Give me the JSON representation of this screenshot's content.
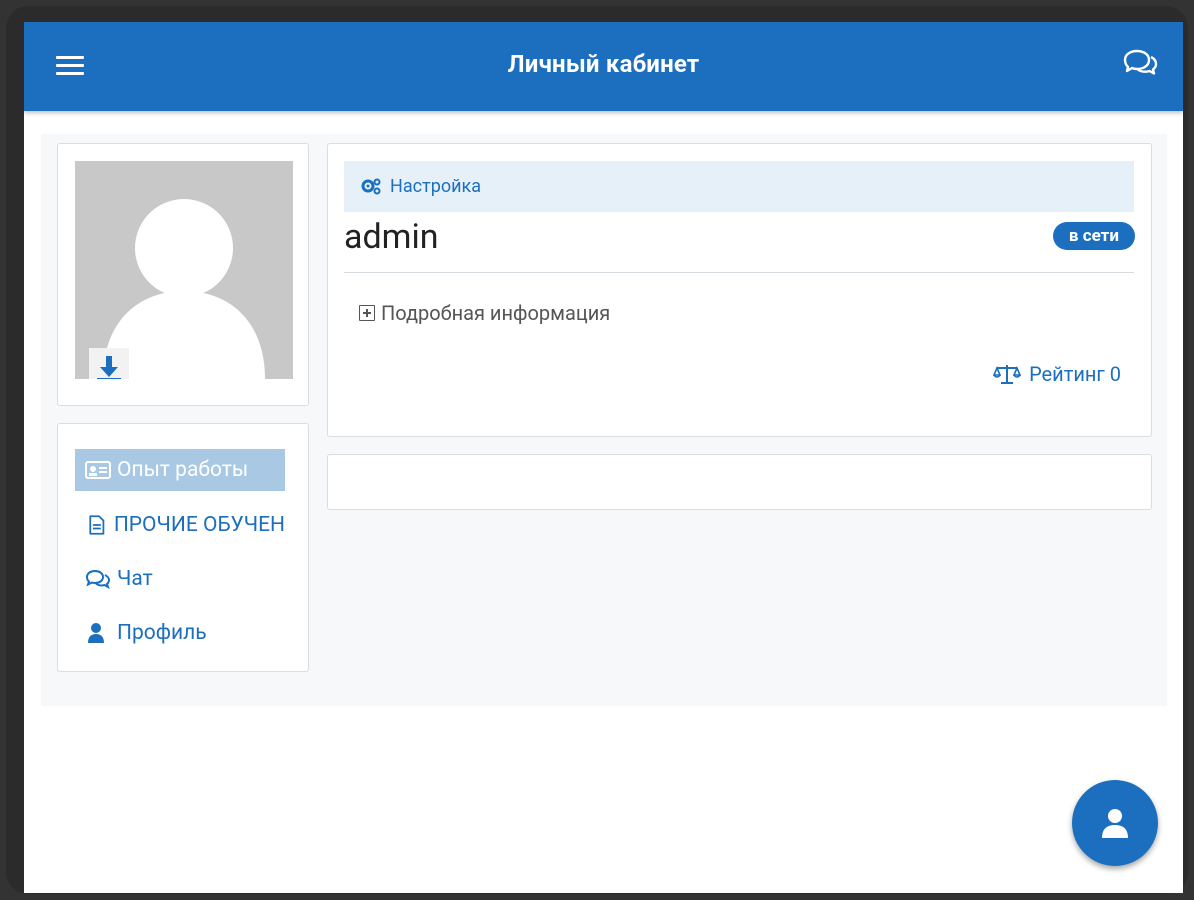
{
  "header": {
    "title": "Личный кабинет"
  },
  "profile": {
    "username": "admin",
    "status_badge": "в сети",
    "settings_label": "Настройка",
    "details_label": "Подробная информация",
    "rating_label": "Рейтинг 0"
  },
  "sidebar": {
    "items": [
      {
        "label": "Опыт работы",
        "icon": "id-card-icon",
        "active": true
      },
      {
        "label": "ПРОЧИЕ ОБУЧЕН",
        "icon": "document-icon",
        "active": false
      },
      {
        "label": "Чат",
        "icon": "chat-icon",
        "active": false
      },
      {
        "label": "Профиль",
        "icon": "user-icon",
        "active": false
      }
    ]
  },
  "colors": {
    "primary": "#1c6fbf",
    "active_item_bg": "#a9c8e4",
    "settings_bg": "#e6f0f9"
  }
}
